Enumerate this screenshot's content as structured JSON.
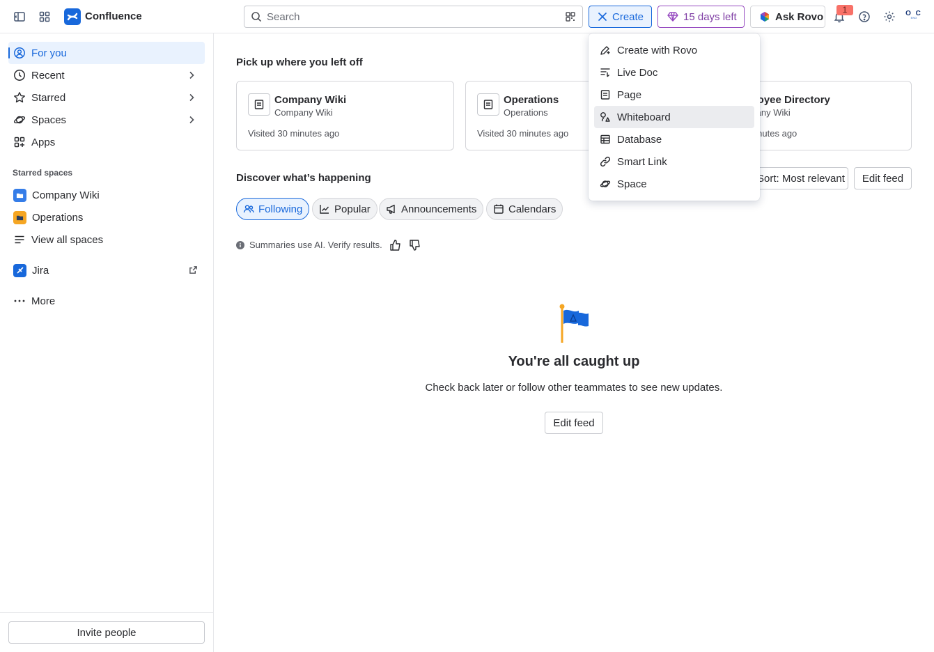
{
  "topbar": {
    "app_name": "Confluence",
    "search_placeholder": "Search",
    "create_label": "Create",
    "trial_label": "15 days left",
    "rovo_label": "Ask Rovo",
    "notification_count": "1",
    "avatar_initials": "O C",
    "avatar_sub": "ENG"
  },
  "sidebar": {
    "items": [
      {
        "label": "For you"
      },
      {
        "label": "Recent"
      },
      {
        "label": "Starred"
      },
      {
        "label": "Spaces"
      },
      {
        "label": "Apps"
      }
    ],
    "starred_spaces_label": "Starred spaces",
    "spaces": [
      {
        "label": "Company Wiki",
        "color": "#357de8"
      },
      {
        "label": "Operations",
        "color": "#f5a623"
      }
    ],
    "view_all_label": "View all spaces",
    "jira_label": "Jira",
    "more_label": "More",
    "invite_label": "Invite people"
  },
  "main": {
    "recent_heading": "Pick up where you left off",
    "cards": [
      {
        "title": "Company Wiki",
        "subtitle": "Company Wiki",
        "meta": "Visited 30 minutes ago"
      },
      {
        "title": "Operations",
        "subtitle": "Operations",
        "meta": "Visited 30 minutes ago"
      },
      {
        "title": "Employee Directory",
        "subtitle": "Company Wiki",
        "meta": "Visited 30 minutes ago"
      }
    ],
    "discover_heading": "Discover what’s happening",
    "filters": [
      {
        "label": "Following"
      },
      {
        "label": "Popular"
      },
      {
        "label": "Announcements"
      },
      {
        "label": "Calendars"
      }
    ],
    "sort_label": "Sort: Most relevant",
    "edit_feed_label": "Edit feed",
    "ai_note": "Summaries use AI. Verify results.",
    "empty_title": "You're all caught up",
    "empty_desc": "Check back later or follow other teammates to see new updates.",
    "empty_button": "Edit feed"
  },
  "create_menu": {
    "items": [
      {
        "label": "Create with Rovo",
        "icon": "create-with-rovo-icon"
      },
      {
        "label": "Live Doc",
        "icon": "live-doc-icon"
      },
      {
        "label": "Page",
        "icon": "page-icon"
      },
      {
        "label": "Whiteboard",
        "icon": "whiteboard-icon"
      },
      {
        "label": "Database",
        "icon": "database-icon"
      },
      {
        "label": "Smart Link",
        "icon": "smart-link-icon"
      },
      {
        "label": "Space",
        "icon": "space-icon"
      }
    ],
    "hovered_item": "Whiteboard"
  },
  "colors": {
    "accent": "#1868db",
    "trial": "#803fa5",
    "badge": "#f87168"
  }
}
